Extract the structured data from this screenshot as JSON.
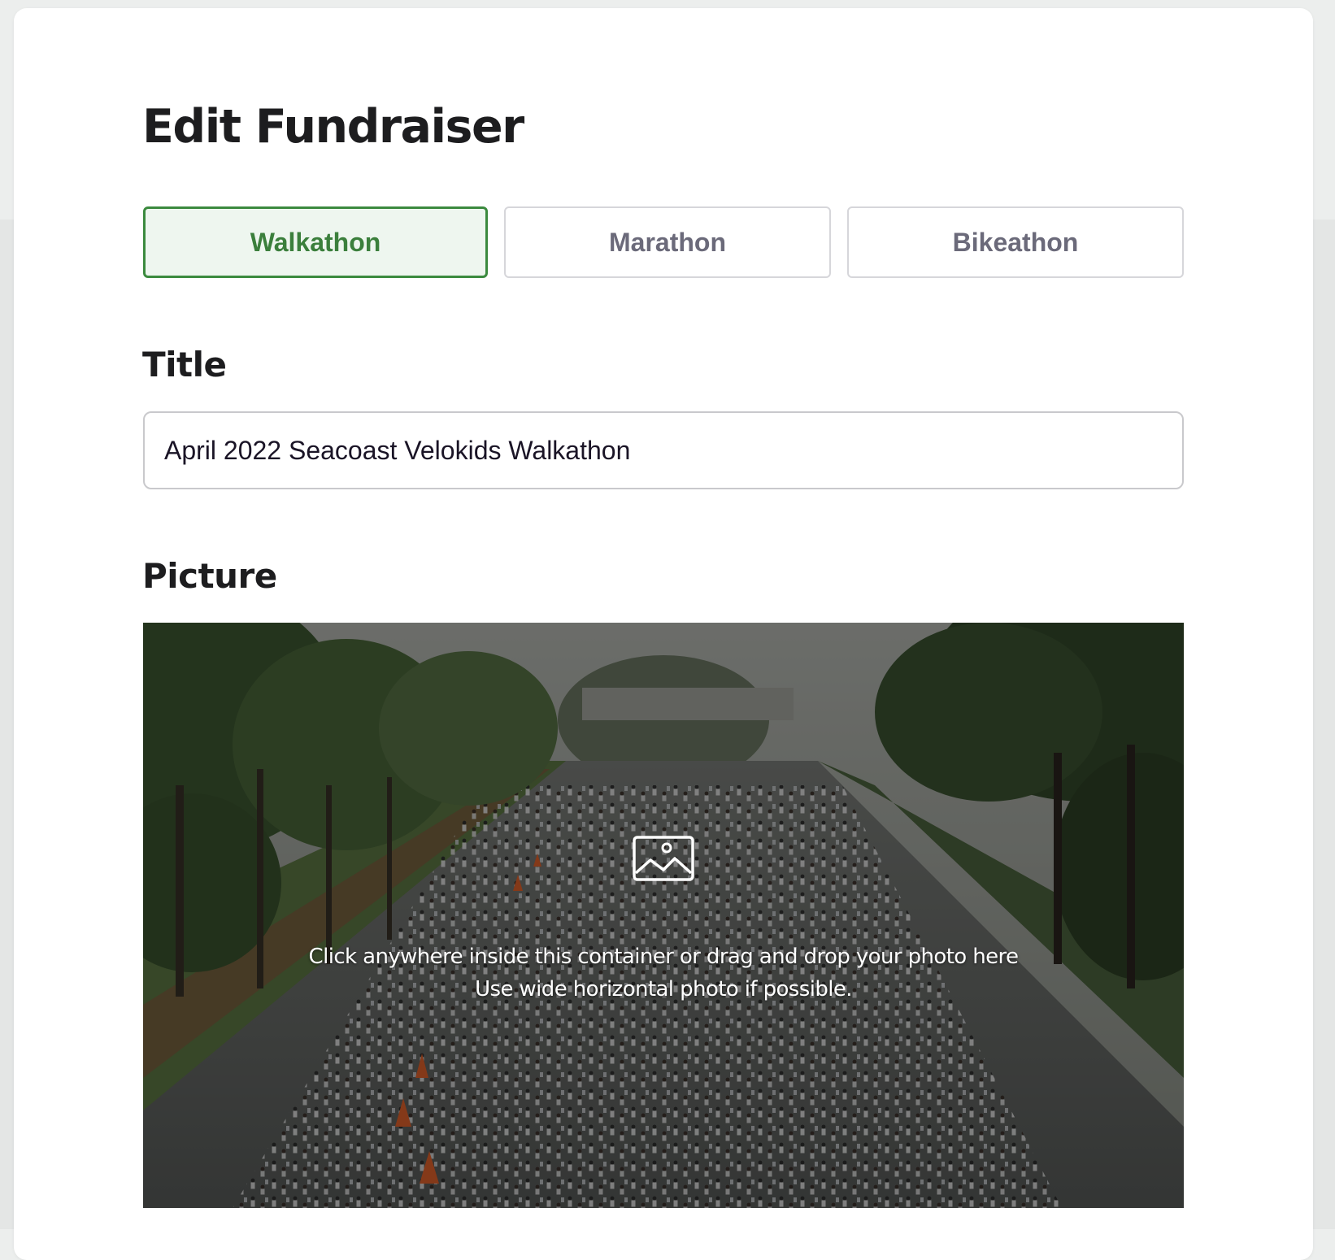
{
  "page": {
    "title": "Edit Fundraiser"
  },
  "event_types": {
    "selected": "Walkathon",
    "options": [
      {
        "label": "Walkathon"
      },
      {
        "label": "Marathon"
      },
      {
        "label": "Bikeathon"
      }
    ]
  },
  "title_field": {
    "label": "Title",
    "value": "April 2022 Seacoast Velokids Walkathon"
  },
  "picture_field": {
    "label": "Picture",
    "instruction_line_1": "Click anywhere inside this container or drag and drop your photo here",
    "instruction_line_2": "Use wide horizontal photo if possible.",
    "icon": "image-icon"
  },
  "colors": {
    "accent_green": "#3b8a3e",
    "selected_tab_bg": "#eef6ef",
    "heading": "#1d1d1f",
    "tab_text": "#6b6a7a"
  }
}
